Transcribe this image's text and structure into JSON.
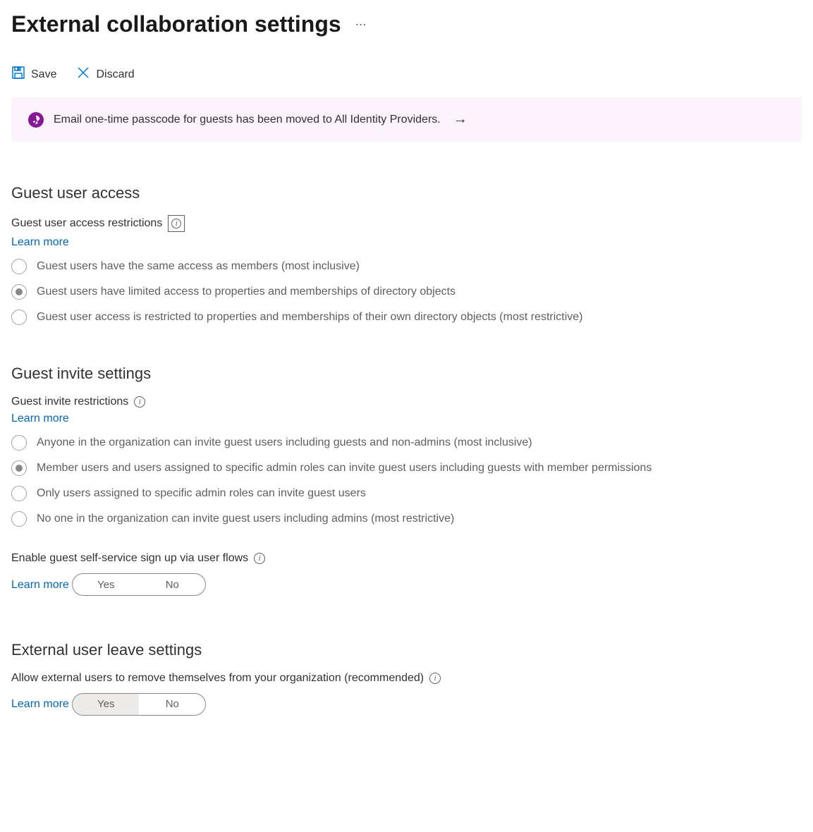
{
  "page": {
    "title": "External collaboration settings"
  },
  "toolbar": {
    "save_label": "Save",
    "discard_label": "Discard"
  },
  "notification": {
    "message": "Email one-time passcode for guests has been moved to All Identity Providers."
  },
  "sections": {
    "guest_access": {
      "heading": "Guest user access",
      "field_label": "Guest user access restrictions",
      "learn_more": "Learn more",
      "options": [
        "Guest users have the same access as members (most inclusive)",
        "Guest users have limited access to properties and memberships of directory objects",
        "Guest user access is restricted to properties and memberships of their own directory objects (most restrictive)"
      ],
      "selected_index": 1
    },
    "guest_invite": {
      "heading": "Guest invite settings",
      "field_label": "Guest invite restrictions",
      "learn_more": "Learn more",
      "options": [
        "Anyone in the organization can invite guest users including guests and non-admins (most inclusive)",
        "Member users and users assigned to specific admin roles can invite guest users including guests with member permissions",
        "Only users assigned to specific admin roles can invite guest users",
        "No one in the organization can invite guest users including admins (most restrictive)"
      ],
      "selected_index": 1,
      "self_service": {
        "label": "Enable guest self-service sign up via user flows",
        "learn_more": "Learn more",
        "yes_label": "Yes",
        "no_label": "No",
        "selected": "No"
      }
    },
    "external_leave": {
      "heading": "External user leave settings",
      "field_label": "Allow external users to remove themselves from your organization (recommended)",
      "learn_more": "Learn more",
      "yes_label": "Yes",
      "no_label": "No",
      "selected": "Yes"
    }
  },
  "colors": {
    "link": "#0067b8",
    "accent": "#0078d4",
    "notification_bg": "#fcf2fc",
    "notification_icon": "#881798"
  }
}
